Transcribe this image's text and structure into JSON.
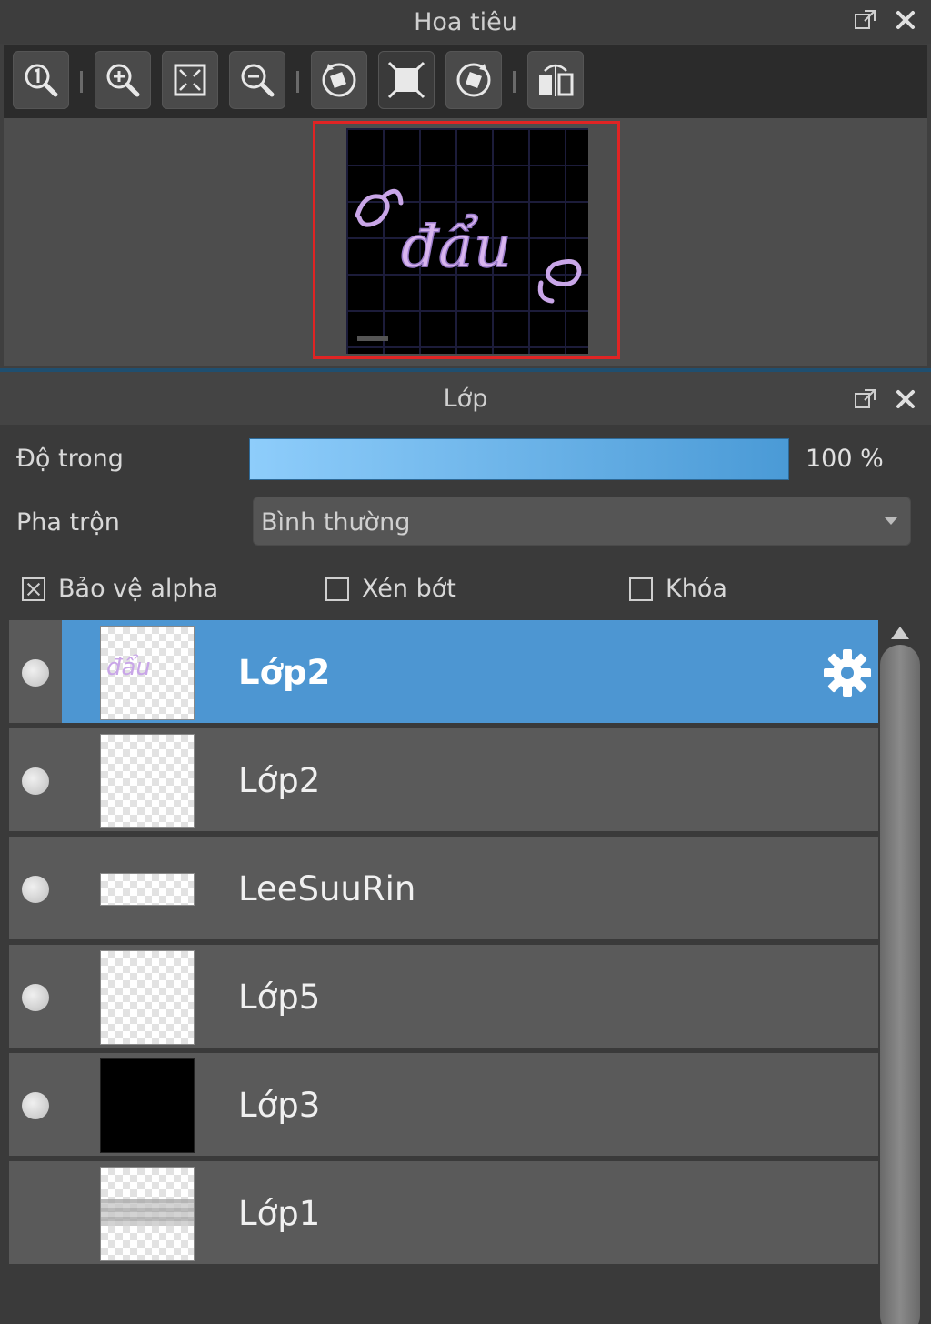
{
  "navigator": {
    "title": "Hoa tiêu",
    "toolbar": [
      {
        "icon": "zoom-actual-icon"
      },
      {
        "icon": "zoom-in-icon"
      },
      {
        "icon": "fit-screen-icon"
      },
      {
        "icon": "zoom-out-icon"
      },
      {
        "icon": "rotate-left-icon"
      },
      {
        "icon": "reset-view-icon"
      },
      {
        "icon": "rotate-right-icon"
      },
      {
        "icon": "flip-horizontal-icon"
      }
    ],
    "preview_text": "đẩu"
  },
  "layers_panel": {
    "title": "Lớp",
    "opacity_label": "Độ trong",
    "opacity_value": "100 %",
    "opacity_fraction": 1.0,
    "blend_label": "Pha trộn",
    "blend_value": "Bình thường",
    "checkboxes": {
      "protect_alpha": {
        "label": "Bảo vệ alpha",
        "checked": true
      },
      "clipping": {
        "label": "Xén bớt",
        "checked": false
      },
      "lock": {
        "label": "Khóa",
        "checked": false
      }
    },
    "layers": [
      {
        "name": "Lớp2",
        "selected": true
      },
      {
        "name": "Lớp2",
        "selected": false
      },
      {
        "name": "LeeSuuRin",
        "selected": false
      },
      {
        "name": "Lớp5",
        "selected": false
      },
      {
        "name": "Lớp3",
        "selected": false
      },
      {
        "name": "Lớp1",
        "selected": false
      }
    ],
    "thumb_text": "đẩu"
  },
  "colors": {
    "accent": "#4d96d2",
    "frame": "#e02424",
    "preview_text": "#c9a6e8"
  }
}
